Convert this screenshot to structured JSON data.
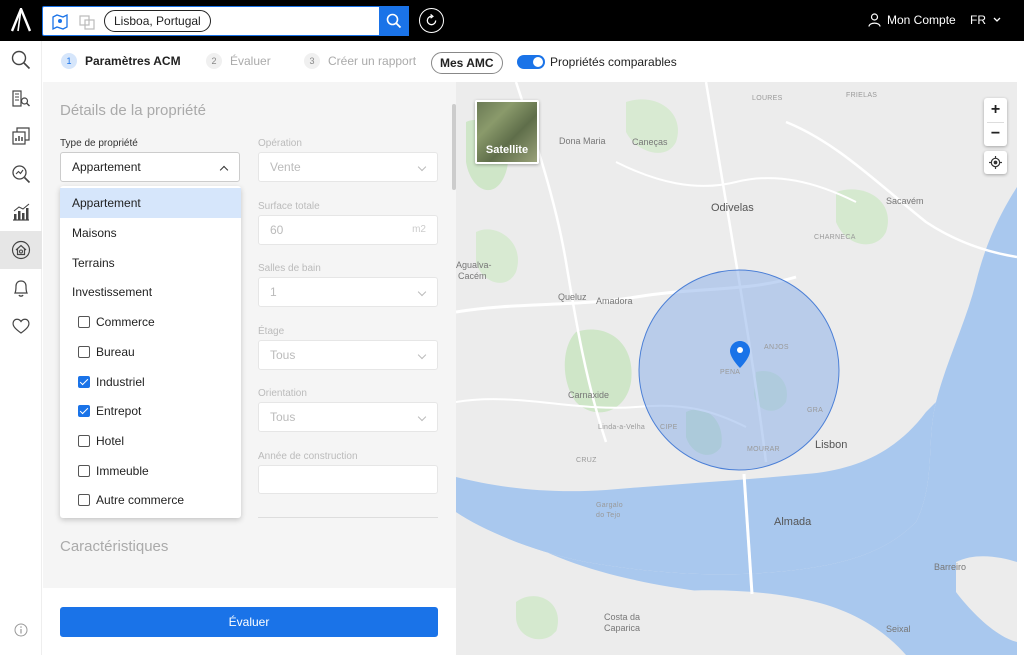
{
  "header": {
    "search": {
      "location_chip": "Lisboa, Portugal"
    },
    "account_label": "Mon Compte",
    "language": "FR"
  },
  "sidebar": {
    "icons": [
      "search-icon",
      "building-search-icon",
      "report-icon",
      "analytics-search-icon",
      "bar-chart-icon",
      "home-valuation-icon",
      "bell-icon",
      "heart-icon",
      "info-icon"
    ],
    "active": "home-valuation-icon"
  },
  "steps": [
    {
      "num": "1",
      "label": "Paramètres ACM"
    },
    {
      "num": "2",
      "label": "Évaluer"
    },
    {
      "num": "3",
      "label": "Créer un rapport"
    }
  ],
  "mes_amc_label": "Mes AMC",
  "comparables_toggle": {
    "label": "Propriétés comparables",
    "on": true
  },
  "form": {
    "section_title": "Détails de la propriété",
    "section2_title": "Caractéristiques",
    "property_type": {
      "label": "Type de propriété",
      "value": "Appartement"
    },
    "operation": {
      "label": "Opération",
      "value": "Vente"
    },
    "surface": {
      "label": "Surface totale",
      "value": "60",
      "unit": "m2"
    },
    "bathrooms": {
      "label": "Salles de bain",
      "value": "1"
    },
    "floor": {
      "label": "Étage",
      "value": "Tous"
    },
    "orientation": {
      "label": "Orientation",
      "value": "Tous"
    },
    "year_built": {
      "label": "Année de construction",
      "value": ""
    }
  },
  "dropdown": {
    "options": [
      "Appartement",
      "Maisons",
      "Terrains",
      "Investissement"
    ],
    "investment_subtypes": [
      {
        "label": "Commerce",
        "checked": false
      },
      {
        "label": "Bureau",
        "checked": false
      },
      {
        "label": "Industriel",
        "checked": true
      },
      {
        "label": "Entrepot",
        "checked": true
      },
      {
        "label": "Hotel",
        "checked": false
      },
      {
        "label": "Immeuble",
        "checked": false
      },
      {
        "label": "Autre commerce",
        "checked": false
      }
    ]
  },
  "evaluate_button": "Évaluer",
  "map": {
    "satellite_label": "Satellite",
    "zoom_in": "+",
    "zoom_out": "−",
    "places": {
      "odivelas": "Odivelas",
      "lisbon": "Lisbon",
      "almada": "Almada",
      "amadora": "Amadora",
      "queluz": "Queluz",
      "carnaxide": "Carnaxide",
      "agualva": "Agualva-",
      "cacem": "Cacém",
      "sacavem": "Sacavém",
      "pena": "PENA",
      "anjos": "ANJOS",
      "mouraria": "MOURAR",
      "principe": "CIPE",
      "graca": "GRA",
      "loures": "LOURES",
      "frielas": "FRIELAS",
      "charneca": "CHARNECA",
      "dona_maria": "Dona Maria",
      "canecas": "Caneças",
      "linda": "Linda-a-Velha",
      "cruz": "CRUZ",
      "barreiro": "Barreiro",
      "seixal": "Seixal",
      "costa": "Costa da",
      "caparica": "Caparica",
      "gargalo": "Gargalo",
      "tejo": "do Tejo"
    }
  },
  "colors": {
    "accent": "#1a73e8",
    "topbar": "#000000",
    "water": "#a9c8ee",
    "park": "#cfe6c8",
    "circle_fill": "#8fb3ea"
  }
}
